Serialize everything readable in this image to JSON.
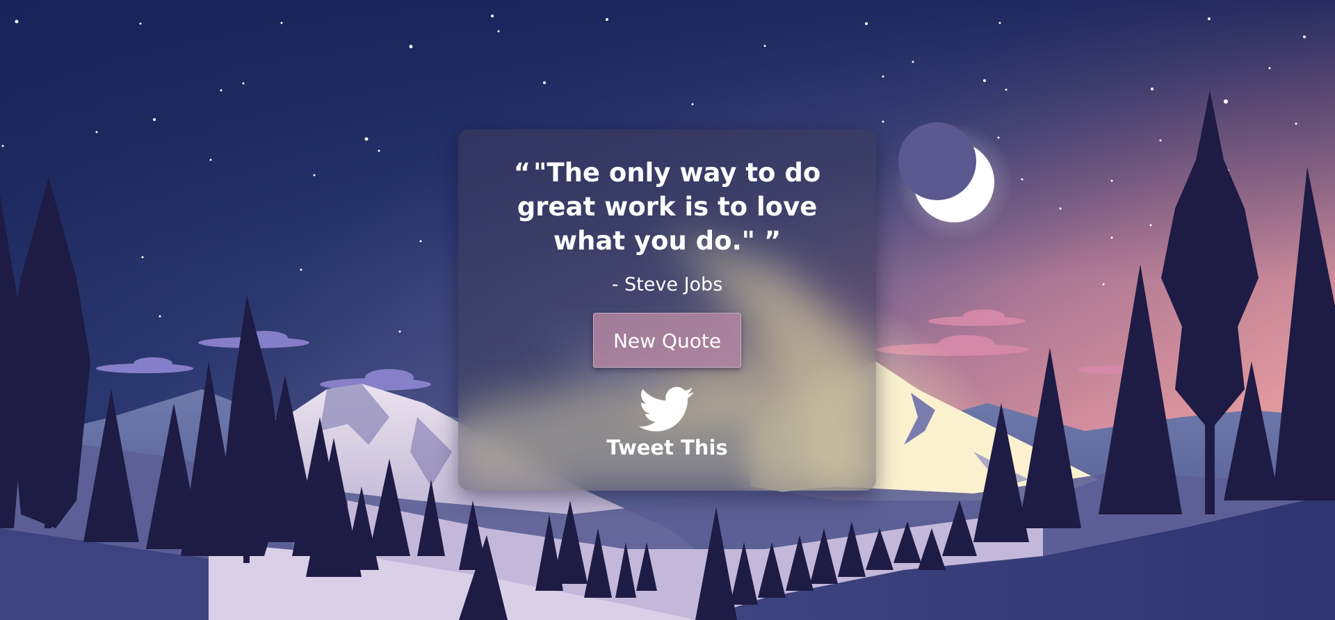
{
  "quote": {
    "open_mark": "“",
    "text": "\"The only way to do great work is to love what you do.\"",
    "close_mark": "”",
    "author": "- Steve Jobs"
  },
  "actions": {
    "new_quote_label": "New Quote",
    "tweet_label": "Tweet This"
  },
  "icons": {
    "tweet": "twitter-bird-icon",
    "moon": "crescent-moon"
  },
  "colors": {
    "sky_top": "#1a2559",
    "sky_mid": "#4a5a8e",
    "sky_horizon": "#f0a0a8",
    "tree_dark": "#1e1b44",
    "snow": "#f2ecf0",
    "button_bg": "#b084a0",
    "text": "#ffffff"
  }
}
